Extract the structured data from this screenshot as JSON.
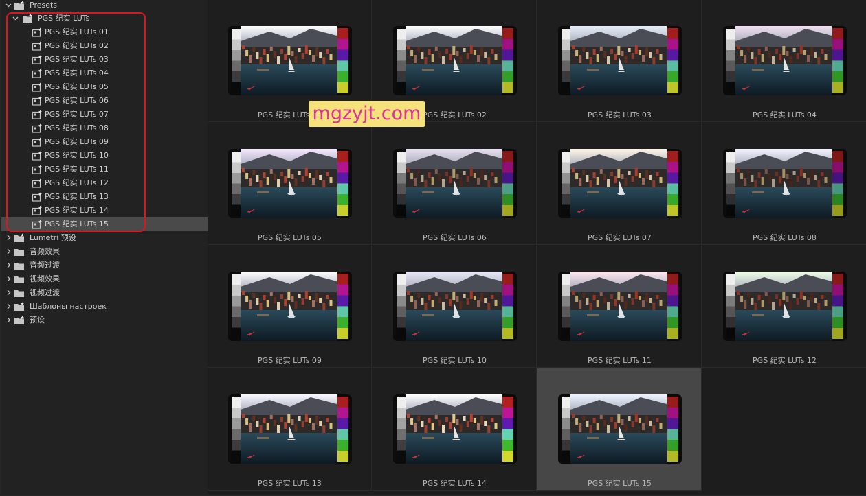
{
  "tree": {
    "root": {
      "label": "Presets"
    },
    "folder": {
      "label": "PGS 纪实 LUTs"
    },
    "children": [
      "PGS 纪实 LUTs 01",
      "PGS 纪实 LUTs 02",
      "PGS 纪实 LUTs 03",
      "PGS 纪实 LUTs 04",
      "PGS 纪实 LUTs 05",
      "PGS 纪实 LUTs 06",
      "PGS 纪实 LUTs 07",
      "PGS 纪实 LUTs 08",
      "PGS 纪实 LUTs 09",
      "PGS 纪实 LUTs 10",
      "PGS 纪实 LUTs 11",
      "PGS 纪实 LUTs 12",
      "PGS 纪实 LUTs 13",
      "PGS 纪实 LUTs 14",
      "PGS 纪实 LUTs 15"
    ],
    "selected_child": 14,
    "others": [
      {
        "label": "Lumetri 预设",
        "icon": "preset-folder-icon"
      },
      {
        "label": "音频效果",
        "icon": "folder-icon"
      },
      {
        "label": "音频过渡",
        "icon": "folder-icon"
      },
      {
        "label": "视频效果",
        "icon": "folder-icon"
      },
      {
        "label": "视频过渡",
        "icon": "folder-icon"
      },
      {
        "label": "Шаблоны настроек",
        "icon": "preset-folder-icon"
      },
      {
        "label": "预设",
        "icon": "preset-folder-icon"
      }
    ]
  },
  "grid": {
    "items": [
      "PGS 纪实 LUTs 01",
      "PGS 纪实 LUTs 02",
      "PGS 纪实 LUTs 03",
      "PGS 纪实 LUTs 04",
      "PGS 纪实 LUTs 05",
      "PGS 纪实 LUTs 06",
      "PGS 纪实 LUTs 07",
      "PGS 纪实 LUTs 08",
      "PGS 纪实 LUTs 09",
      "PGS 纪实 LUTs 10",
      "PGS 纪实 LUTs 11",
      "PGS 纪实 LUTs 12",
      "PGS 纪实 LUTs 13",
      "PGS 纪实 LUTs 14",
      "PGS 纪实 LUTs 15"
    ],
    "selected_index": 14
  },
  "watermark": "mgzyjt.com",
  "colors": {
    "highlight": "#e0141c",
    "watermark_bg": "#f6e27a",
    "watermark_text": "#e0309a",
    "swatches": [
      "#a8201e",
      "#b3148f",
      "#5a1aa8",
      "#5fc7a8",
      "#3bb02c",
      "#c8cf2a"
    ],
    "grays": [
      "#eeeeee",
      "#c9c9c9",
      "#9a9a9a",
      "#6a6a6a",
      "#3c3c3c",
      "#0a0a0a"
    ]
  }
}
